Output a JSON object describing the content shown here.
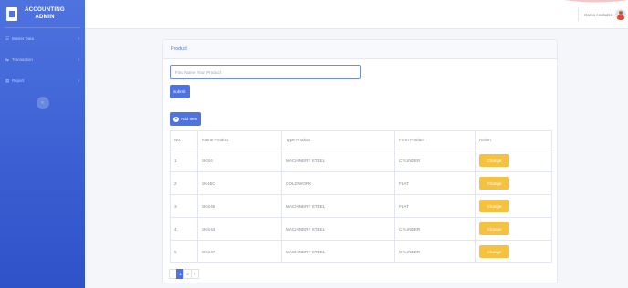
{
  "sidebar": {
    "brand_line1": "ACCOUNTING",
    "brand_line2": "ADMIN",
    "items": [
      {
        "label": "Master Data",
        "icon": "☰"
      },
      {
        "label": "Transaction",
        "icon": "⇆"
      },
      {
        "label": "Report",
        "icon": "▤"
      }
    ],
    "toggle_glyph": "‹"
  },
  "topbar": {
    "user_name": "Gama Anafadza"
  },
  "card": {
    "title": "Product",
    "search_placeholder": "Find Name Your Product",
    "submit_label": "submit",
    "add_label": "Add Item"
  },
  "table": {
    "headers": [
      "No.",
      "Name Product",
      "Type Product",
      "Form Product",
      "Action"
    ],
    "rows": [
      {
        "no": "1",
        "name": "SKS4",
        "type": "MACHINERY STEEL",
        "form": "CYLINDER",
        "action": "Change"
      },
      {
        "no": "2",
        "name": "SK45C",
        "type": "COLD WORK",
        "form": "FLAT",
        "action": "Change"
      },
      {
        "no": "3",
        "name": "SKS46",
        "type": "MACHINERY STEEL",
        "form": "FLAT",
        "action": "Change"
      },
      {
        "no": "4",
        "name": "SKS44",
        "type": "MACHINERY STEEL",
        "form": "CYLINDER",
        "action": "Change"
      },
      {
        "no": "5",
        "name": "SKS47",
        "type": "MACHINERY STEEL",
        "form": "CYLINDER",
        "action": "Change"
      }
    ]
  },
  "pagination": {
    "prev": "‹",
    "pages": [
      "1",
      "2"
    ],
    "next": "›",
    "active": "1"
  },
  "colors": {
    "primary": "#4e73df",
    "warning": "#f6c23e",
    "background": "#f5f6fa"
  }
}
